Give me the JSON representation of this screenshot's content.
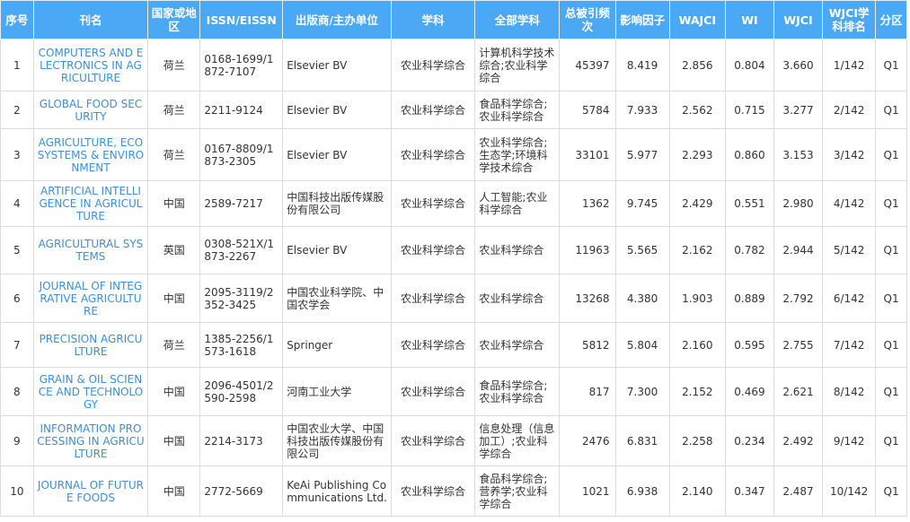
{
  "headers": {
    "index": "序号",
    "journal": "刊名",
    "country": "国家或地区",
    "issn": "ISSN/EISSN",
    "publisher": "出版商/主办单位",
    "subject": "学科",
    "all_subjects": "全部学科",
    "citations": "总被引频次",
    "impact": "影响因子",
    "wajci": "WAJCI",
    "wi": "WI",
    "wjci": "WJCI",
    "rank": "WJCI学科排名",
    "quartile": "分区"
  },
  "rows": [
    {
      "index": "1",
      "journal": "COMPUTERS AND ELECTRONICS IN AGRICULTURE",
      "country": "荷兰",
      "issn": "0168-1699/1872-7107",
      "publisher": "Elsevier BV",
      "subject": "农业科学综合",
      "all_subjects": "计算机科学技术综合;农业科学综合",
      "citations": "45397",
      "impact": "8.419",
      "wajci": "2.856",
      "wi": "0.804",
      "wjci": "3.660",
      "rank": "1/142",
      "quartile": "Q1"
    },
    {
      "index": "2",
      "journal": "GLOBAL FOOD SECURITY",
      "country": "荷兰",
      "issn": "2211-9124",
      "publisher": "Elsevier BV",
      "subject": "农业科学综合",
      "all_subjects": "食品科学综合;农业科学综合",
      "citations": "5784",
      "impact": "7.933",
      "wajci": "2.562",
      "wi": "0.715",
      "wjci": "3.277",
      "rank": "2/142",
      "quartile": "Q1"
    },
    {
      "index": "3",
      "journal": "AGRICULTURE, ECOSYSTEMS & ENVIRONMENT",
      "country": "荷兰",
      "issn": "0167-8809/1873-2305",
      "publisher": "Elsevier BV",
      "subject": "农业科学综合",
      "all_subjects": "农业科学综合;生态学;环境科学技术综合",
      "citations": "33101",
      "impact": "5.977",
      "wajci": "2.293",
      "wi": "0.860",
      "wjci": "3.153",
      "rank": "3/142",
      "quartile": "Q1"
    },
    {
      "index": "4",
      "journal": "ARTIFICIAL INTELLIGENCE IN AGRICULTURE",
      "country": "中国",
      "issn": "2589-7217",
      "publisher": "中国科技出版传媒股份有限公司",
      "subject": "农业科学综合",
      "all_subjects": "人工智能;农业科学综合",
      "citations": "1362",
      "impact": "9.745",
      "wajci": "2.429",
      "wi": "0.551",
      "wjci": "2.980",
      "rank": "4/142",
      "quartile": "Q1"
    },
    {
      "index": "5",
      "journal": "AGRICULTURAL SYSTEMS",
      "country": "英国",
      "issn": "0308-521X/1873-2267",
      "publisher": "Elsevier BV",
      "subject": "农业科学综合",
      "all_subjects": "农业科学综合",
      "citations": "11963",
      "impact": "5.565",
      "wajci": "2.162",
      "wi": "0.782",
      "wjci": "2.944",
      "rank": "5/142",
      "quartile": "Q1"
    },
    {
      "index": "6",
      "journal": "JOURNAL OF INTEGRATIVE AGRICULTURE",
      "country": "中国",
      "issn": "2095-3119/2352-3425",
      "publisher": "中国农业科学院、中国农学会",
      "subject": "农业科学综合",
      "all_subjects": "农业科学综合",
      "citations": "13268",
      "impact": "4.380",
      "wajci": "1.903",
      "wi": "0.889",
      "wjci": "2.792",
      "rank": "6/142",
      "quartile": "Q1"
    },
    {
      "index": "7",
      "journal": "PRECISION AGRICULTURE",
      "country": "荷兰",
      "issn": "1385-2256/1573-1618",
      "publisher": "Springer",
      "subject": "农业科学综合",
      "all_subjects": "农业科学综合",
      "citations": "5812",
      "impact": "5.804",
      "wajci": "2.160",
      "wi": "0.595",
      "wjci": "2.755",
      "rank": "7/142",
      "quartile": "Q1"
    },
    {
      "index": "8",
      "journal": "GRAIN & OIL SCIENCE AND TECHNOLOGY",
      "country": "中国",
      "issn": "2096-4501/2590-2598",
      "publisher": "河南工业大学",
      "subject": "农业科学综合",
      "all_subjects": "食品科学综合;农业科学综合",
      "citations": "817",
      "impact": "7.300",
      "wajci": "2.152",
      "wi": "0.469",
      "wjci": "2.621",
      "rank": "8/142",
      "quartile": "Q1"
    },
    {
      "index": "9",
      "journal": "INFORMATION PROCESSING IN AGRICULTURE",
      "country": "中国",
      "issn": "2214-3173",
      "publisher": "中国农业大学、中国科技出版传媒股份有限公司",
      "subject": "农业科学综合",
      "all_subjects": "信息处理（信息加工）;农业科学综合",
      "citations": "2476",
      "impact": "6.831",
      "wajci": "2.258",
      "wi": "0.234",
      "wjci": "2.492",
      "rank": "9/142",
      "quartile": "Q1"
    },
    {
      "index": "10",
      "journal": "JOURNAL OF FUTURE FOODS",
      "country": "中国",
      "issn": "2772-5669",
      "publisher": "KeAi Publishing Communications Ltd.",
      "subject": "农业科学综合",
      "all_subjects": "食品科学综合;营养学;农业科学综合",
      "citations": "1021",
      "impact": "6.938",
      "wajci": "2.140",
      "wi": "0.347",
      "wjci": "2.487",
      "rank": "10/142",
      "quartile": "Q1"
    }
  ]
}
